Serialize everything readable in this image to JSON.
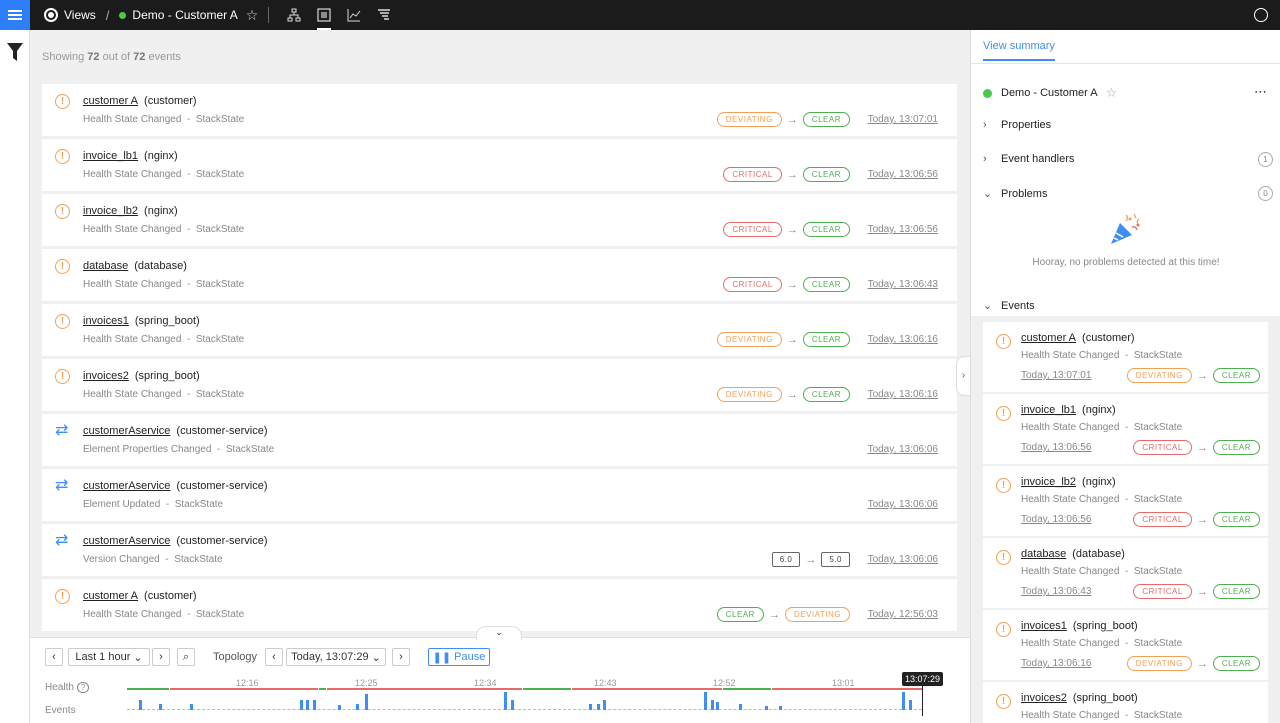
{
  "topbar": {
    "views_label": "Views",
    "view_name": "Demo - Customer A"
  },
  "main": {
    "showing_prefix": "Showing",
    "showing_count": "72",
    "showing_mid": "out of",
    "showing_total": "72",
    "showing_suffix": "events",
    "events": [
      {
        "icon": "warning",
        "name": "customer A",
        "type": "(customer)",
        "desc": "Health State Changed",
        "source": "StackState",
        "from": "DEVIATING",
        "from_kind": "dev",
        "to": "CLEAR",
        "to_kind": "clear",
        "time": "Today, 13:07:01"
      },
      {
        "icon": "warning",
        "name": "invoice_lb1",
        "type": "(nginx)",
        "desc": "Health State Changed",
        "source": "StackState",
        "from": "CRITICAL",
        "from_kind": "crit",
        "to": "CLEAR",
        "to_kind": "clear",
        "time": "Today, 13:06:56"
      },
      {
        "icon": "warning",
        "name": "invoice_lb2",
        "type": "(nginx)",
        "desc": "Health State Changed",
        "source": "StackState",
        "from": "CRITICAL",
        "from_kind": "crit",
        "to": "CLEAR",
        "to_kind": "clear",
        "time": "Today, 13:06:56"
      },
      {
        "icon": "warning",
        "name": "database",
        "type": "(database)",
        "desc": "Health State Changed",
        "source": "StackState",
        "from": "CRITICAL",
        "from_kind": "crit",
        "to": "CLEAR",
        "to_kind": "clear",
        "time": "Today, 13:06:43"
      },
      {
        "icon": "warning",
        "name": "invoices1",
        "type": "(spring_boot)",
        "desc": "Health State Changed",
        "source": "StackState",
        "from": "DEVIATING",
        "from_kind": "dev",
        "to": "CLEAR",
        "to_kind": "clear",
        "time": "Today, 13:06:16"
      },
      {
        "icon": "warning",
        "name": "invoices2",
        "type": "(spring_boot)",
        "desc": "Health State Changed",
        "source": "StackState",
        "from": "DEVIATING",
        "from_kind": "dev",
        "to": "CLEAR",
        "to_kind": "clear",
        "time": "Today, 13:06:16"
      },
      {
        "icon": "swap",
        "name": "customerAservice",
        "type": "(customer-service)",
        "desc": "Element Properties Changed",
        "source": "StackState",
        "from": "",
        "from_kind": "",
        "to": "",
        "to_kind": "",
        "time": "Today, 13:06:06"
      },
      {
        "icon": "swap",
        "name": "customerAservice",
        "type": "(customer-service)",
        "desc": "Element Updated",
        "source": "StackState",
        "from": "",
        "from_kind": "",
        "to": "",
        "to_kind": "",
        "time": "Today, 13:06:06"
      },
      {
        "icon": "swap",
        "name": "customerAservice",
        "type": "(customer-service)",
        "desc": "Version Changed",
        "source": "StackState",
        "from": "6.0",
        "from_kind": "ver",
        "to": "5.0",
        "to_kind": "ver",
        "time": "Today, 13:06:06"
      },
      {
        "icon": "warning",
        "name": "customer A",
        "type": "(customer)",
        "desc": "Health State Changed",
        "source": "StackState",
        "from": "CLEAR",
        "from_kind": "clear",
        "to": "DEVIATING",
        "to_kind": "dev",
        "time": "Today, 12:56:03"
      }
    ]
  },
  "timeline": {
    "range": "Last 1 hour",
    "topology_label": "Topology",
    "topology_time": "Today, 13:07:29",
    "pause_label": "Pause",
    "health_label": "Health",
    "events_label": "Events",
    "ticks": [
      "12:16",
      "12:25",
      "12:34",
      "12:43",
      "12:52",
      "13:01"
    ],
    "cursor_time": "13:07:29"
  },
  "right": {
    "tab": "View summary",
    "view_name": "Demo - Customer A",
    "sections": {
      "properties": "Properties",
      "handlers": "Event handlers",
      "handlers_count": "1",
      "problems": "Problems",
      "problems_count": "0",
      "events": "Events"
    },
    "hooray": "Hooray, no problems detected at this time!",
    "events": [
      {
        "name": "customer A",
        "type": "(customer)",
        "desc": "Health State Changed",
        "source": "StackState",
        "time": "Today, 13:07:01",
        "from": "DEVIATING",
        "from_kind": "dev",
        "to": "CLEAR",
        "to_kind": "clear"
      },
      {
        "name": "invoice_lb1",
        "type": "(nginx)",
        "desc": "Health State Changed",
        "source": "StackState",
        "time": "Today, 13:06:56",
        "from": "CRITICAL",
        "from_kind": "crit",
        "to": "CLEAR",
        "to_kind": "clear"
      },
      {
        "name": "invoice_lb2",
        "type": "(nginx)",
        "desc": "Health State Changed",
        "source": "StackState",
        "time": "Today, 13:06:56",
        "from": "CRITICAL",
        "from_kind": "crit",
        "to": "CLEAR",
        "to_kind": "clear"
      },
      {
        "name": "database",
        "type": "(database)",
        "desc": "Health State Changed",
        "source": "StackState",
        "time": "Today, 13:06:43",
        "from": "CRITICAL",
        "from_kind": "crit",
        "to": "CLEAR",
        "to_kind": "clear"
      },
      {
        "name": "invoices1",
        "type": "(spring_boot)",
        "desc": "Health State Changed",
        "source": "StackState",
        "time": "Today, 13:06:16",
        "from": "DEVIATING",
        "from_kind": "dev",
        "to": "CLEAR",
        "to_kind": "clear"
      },
      {
        "name": "invoices2",
        "type": "(spring_boot)",
        "desc": "Health State Changed",
        "source": "StackState",
        "time": "",
        "from": "",
        "from_kind": "",
        "to": "",
        "to_kind": ""
      }
    ]
  },
  "colors": {
    "accent": "#3f8ef5",
    "clear": "#4caf50",
    "deviating": "#f0a058",
    "critical": "#e66a6a"
  }
}
